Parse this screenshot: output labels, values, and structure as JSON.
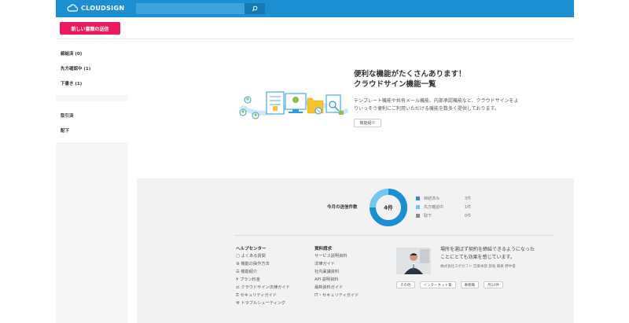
{
  "header": {
    "logo_text": "CLOUDSIGN",
    "search_placeholder": "",
    "brand_color": "#1b8fd2"
  },
  "toolbar": {
    "new_doc_label": "新しい書類の送信",
    "accent_color": "#ec1a5a"
  },
  "sidebar": {
    "group1": [
      "締結済 (0)",
      "先方確認中 (1)",
      "下書き (1)"
    ],
    "group2": [
      "取引済",
      "配下"
    ]
  },
  "promo": {
    "title_line1": "便利な機能がたくさんあります！",
    "title_line2": "クラウドサイン機能一覧",
    "desc_line1": "テンプレート機能や共有メール機能、内部承認機能など、クラウドサインをよ",
    "desc_line2": "りいっそう便利にご利用いただける機能を数多く提供しております。",
    "button_label": "機能紹介"
  },
  "stats": {
    "label": "今月の送信件数",
    "total_text": "4件",
    "legend": [
      {
        "label": "締結済み",
        "value": "3件",
        "color": "#1b8fd2"
      },
      {
        "label": "先方確認中",
        "value": "1件",
        "color": "#74c6ee"
      },
      {
        "label": "取下",
        "value": "0件",
        "color": "#888888"
      }
    ]
  },
  "help_center": {
    "title": "ヘルプセンター",
    "links": [
      "よくある質問",
      "機能の操作方法",
      "機能紹介",
      "プラン料金",
      "クラウドサイン法律ガイド",
      "セキュリティガイド",
      "トラブルシューティング"
    ]
  },
  "docs": {
    "title": "資料請求",
    "links": [
      "サービス説明資料",
      "法律ガイド",
      "社内稟議資料",
      "API 説明資料",
      "最新資料ガイド",
      "IT・セキュリティガイド"
    ]
  },
  "testimonial": {
    "quote_line1": "場所を選ばず契約を締結できるようになった",
    "quote_line2": "ことにとても効果を感じています。",
    "company": "株式会社スポカフト 営業本部 部長 職員 野中俊",
    "tags": [
      "その他",
      "インターネット業",
      "事務職",
      "月10件"
    ]
  }
}
